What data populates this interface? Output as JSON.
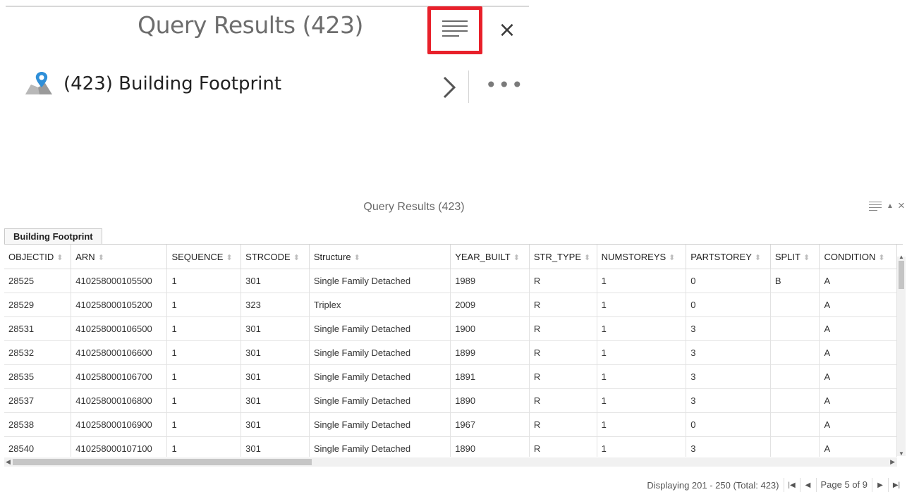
{
  "top_panel": {
    "title": "Query Results (423)",
    "close_glyph": "×",
    "layer": {
      "title": "(423) Building Footprint",
      "more_glyph": "•••"
    }
  },
  "results_panel": {
    "title": "Query Results (423)",
    "tab_label": "Building Footprint",
    "close_glyph": "×",
    "collapse_glyph": "▲",
    "columns": [
      "OBJECTID",
      "ARN",
      "SEQUENCE",
      "STRCODE",
      "Structure",
      "YEAR_BUILT",
      "STR_TYPE",
      "NUMSTOREYS",
      "PARTSTOREY",
      "SPLIT",
      "CONDITION"
    ],
    "rows": [
      [
        "28525",
        "410258000105500",
        "1",
        "301",
        "Single Family Detached",
        "1989",
        "R",
        "1",
        "0",
        "B",
        "A"
      ],
      [
        "28529",
        "410258000105200",
        "1",
        "323",
        "Triplex",
        "2009",
        "R",
        "1",
        "0",
        "",
        "A"
      ],
      [
        "28531",
        "410258000106500",
        "1",
        "301",
        "Single Family Detached",
        "1900",
        "R",
        "1",
        "3",
        "",
        "A"
      ],
      [
        "28532",
        "410258000106600",
        "1",
        "301",
        "Single Family Detached",
        "1899",
        "R",
        "1",
        "3",
        "",
        "A"
      ],
      [
        "28535",
        "410258000106700",
        "1",
        "301",
        "Single Family Detached",
        "1891",
        "R",
        "1",
        "3",
        "",
        "A"
      ],
      [
        "28537",
        "410258000106800",
        "1",
        "301",
        "Single Family Detached",
        "1890",
        "R",
        "1",
        "3",
        "",
        "A"
      ],
      [
        "28538",
        "410258000106900",
        "1",
        "301",
        "Single Family Detached",
        "1967",
        "R",
        "1",
        "0",
        "",
        "A"
      ],
      [
        "28540",
        "410258000107100",
        "1",
        "301",
        "Single Family Detached",
        "1890",
        "R",
        "1",
        "3",
        "",
        "A"
      ]
    ],
    "pager": {
      "displaying": "Displaying 201 - 250 (Total: 423)",
      "page_label": "Page 5 of 9"
    }
  },
  "colors": {
    "highlight": "#e8202a",
    "pin_blue": "#2f8fd8"
  },
  "icons": {
    "menu": "menu-lines-icon",
    "close": "close-icon",
    "layer": "map-pin-layer-icon",
    "chevron": "chevron-right-icon",
    "more": "more-dots-icon",
    "sort": "sort-icon"
  }
}
